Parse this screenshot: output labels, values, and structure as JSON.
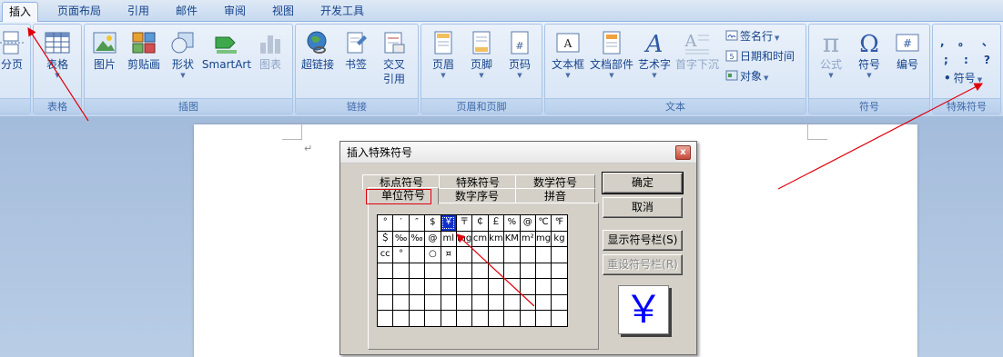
{
  "tabs": [
    "插入",
    "页面布局",
    "引用",
    "邮件",
    "审阅",
    "视图",
    "开发工具"
  ],
  "ribbon": {
    "pages_group": {
      "page_break_label": "分页"
    },
    "table_group": {
      "table_label": "表格",
      "group_label": "表格"
    },
    "illustrations": {
      "picture": "图片",
      "clipart": "剪贴画",
      "shapes": "形状",
      "smartart": "SmartArt",
      "chart": "图表",
      "group_label": "插图"
    },
    "links": {
      "hyperlink": "超链接",
      "bookmark": "书签",
      "crossref_line1": "交叉",
      "crossref_line2": "引用",
      "group_label": "链接"
    },
    "header_footer": {
      "header": "页眉",
      "footer": "页脚",
      "page_number": "页码",
      "group_label": "页眉和页脚"
    },
    "text": {
      "textbox": "文本框",
      "quickparts": "文档部件",
      "wordart": "艺术字",
      "dropcap": "首字下沉",
      "signature_line": "签名行",
      "datetime": "日期和时间",
      "object": "对象",
      "group_label": "文本"
    },
    "symbols": {
      "equation": "公式",
      "symbol": "符号",
      "number": "编号",
      "group_label": "符号"
    },
    "special": {
      "symbol_dropdown": "符号",
      "group_label": "特殊符号",
      "glyphs": [
        ",",
        "。",
        "、",
        ";",
        ":",
        "?"
      ]
    }
  },
  "dialog": {
    "title": "插入特殊符号",
    "close_glyph": "x",
    "tabs_row1": [
      "标点符号",
      "特殊符号",
      "数学符号"
    ],
    "tabs_row2": [
      "单位符号",
      "数字序号",
      "拼音"
    ],
    "active_tab": "单位符号",
    "grid": [
      [
        "°",
        "′",
        "″",
        "$",
        "￥",
        "〒",
        "￠",
        "￡",
        "%",
        "@",
        "℃",
        "℉"
      ],
      [
        "＄",
        "‰",
        "‰",
        "@",
        "ml",
        "mg",
        "cm",
        "km",
        "KM",
        "m²",
        "mg",
        "kg"
      ],
      [
        "cc",
        "°",
        "",
        "○",
        "¤",
        "",
        "",
        "",
        "",
        "",
        "",
        ""
      ],
      [
        "",
        "",
        "",
        "",
        "",
        "",
        "",
        "",
        "",
        "",
        "",
        ""
      ],
      [
        "",
        "",
        "",
        "",
        "",
        "",
        "",
        "",
        "",
        "",
        "",
        ""
      ],
      [
        "",
        "",
        "",
        "",
        "",
        "",
        "",
        "",
        "",
        "",
        "",
        ""
      ],
      [
        "",
        "",
        "",
        "",
        "",
        "",
        "",
        "",
        "",
        "",
        "",
        ""
      ]
    ],
    "selected_cell": "￥",
    "buttons": {
      "ok": "确定",
      "cancel": "取消",
      "show_bar": "显示符号栏(S)",
      "reset_bar": "重设符号栏(R)"
    },
    "preview_glyph": "￥"
  },
  "colors": {
    "accent_red": "#e0000b",
    "selection_blue": "#1030c8"
  }
}
